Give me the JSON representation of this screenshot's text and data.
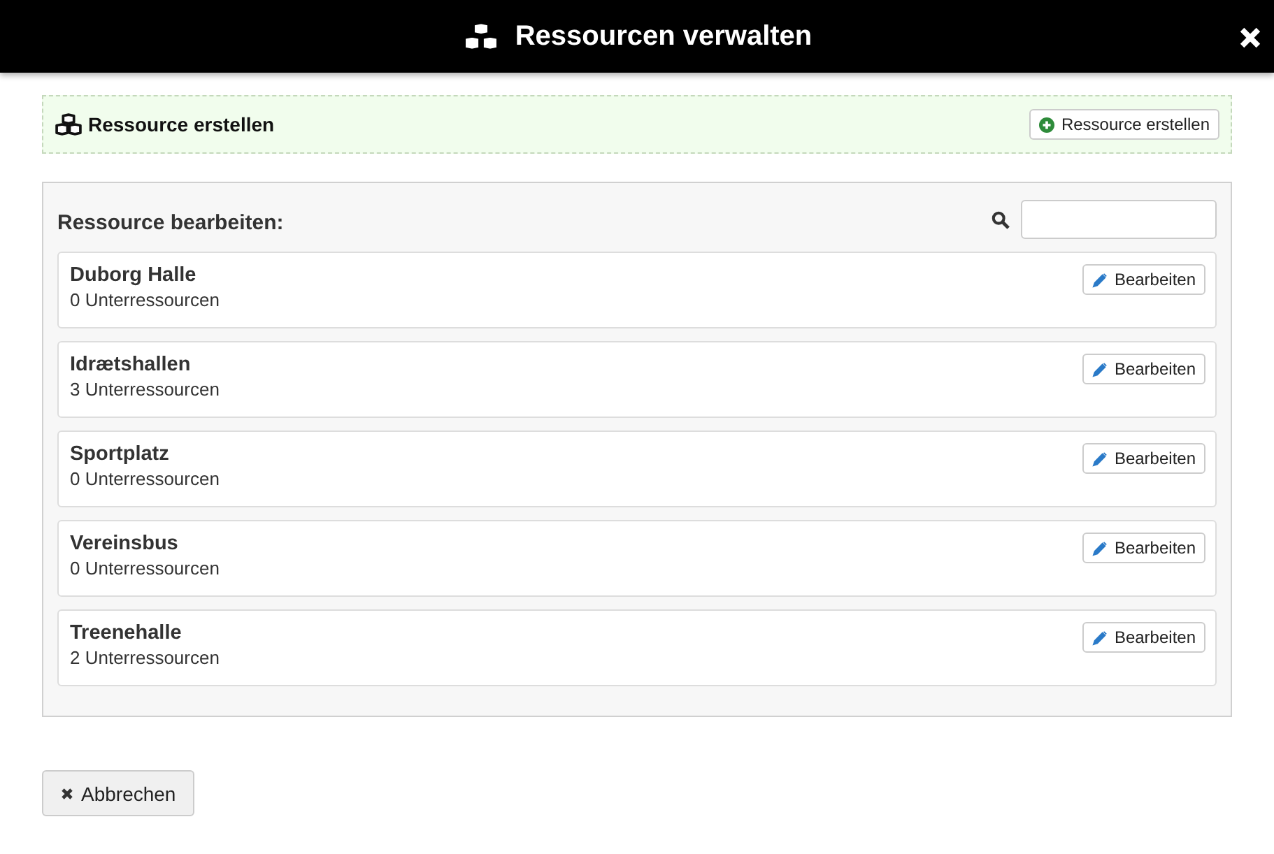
{
  "window": {
    "title": "Ressourcen verwalten"
  },
  "create": {
    "heading": "Ressource erstellen",
    "button": "Ressource erstellen"
  },
  "edit": {
    "heading": "Ressource bearbeiten:",
    "items": [
      {
        "name": "Duborg Halle",
        "count": "0 Unterressourcen",
        "button": "Bearbeiten"
      },
      {
        "name": "Idrætshallen",
        "count": "3 Unterressourcen",
        "button": "Bearbeiten"
      },
      {
        "name": "Sportplatz",
        "count": "0 Unterressourcen",
        "button": "Bearbeiten"
      },
      {
        "name": "Vereinsbus",
        "count": "0 Unterressourcen",
        "button": "Bearbeiten"
      },
      {
        "name": "Treenehalle",
        "count": "2 Unterressourcen",
        "button": "Bearbeiten"
      }
    ]
  },
  "cancel": "Abbrechen"
}
